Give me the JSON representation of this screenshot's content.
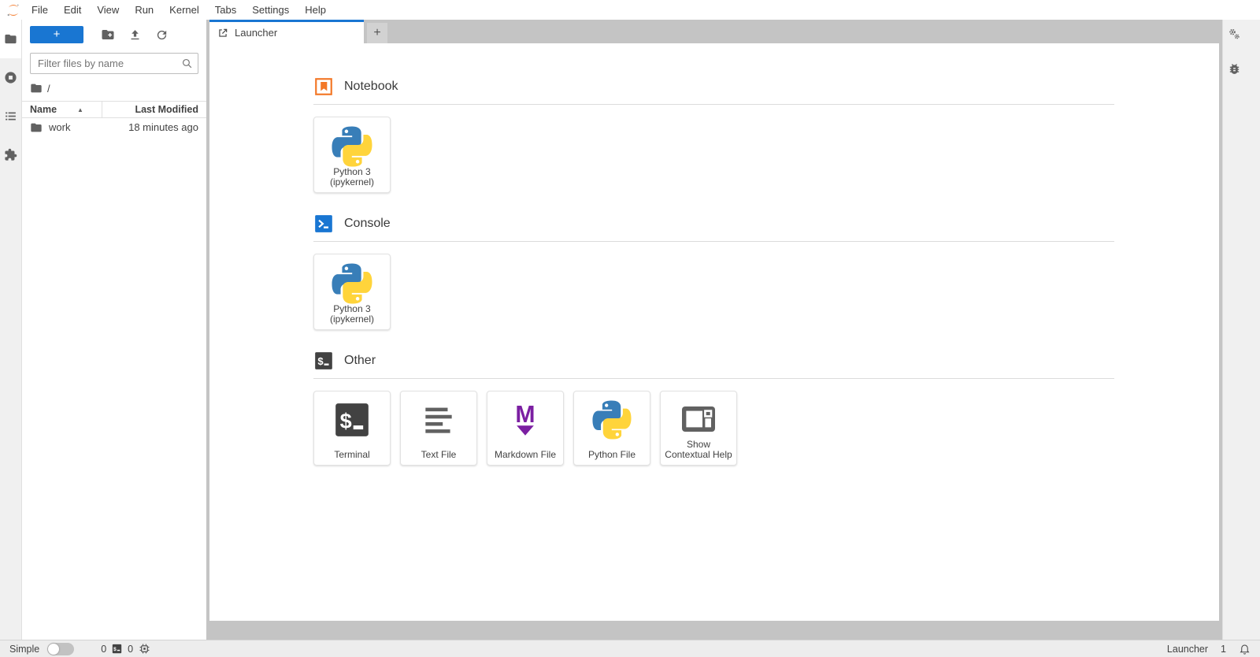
{
  "menubar": {
    "items": [
      "File",
      "Edit",
      "View",
      "Run",
      "Kernel",
      "Tabs",
      "Settings",
      "Help"
    ]
  },
  "sidebar_left": {
    "tabs": [
      {
        "name": "file-browser",
        "icon": "folder-icon",
        "active": true
      },
      {
        "name": "running-kernels",
        "icon": "stop-circle-icon",
        "active": false
      },
      {
        "name": "table-of-contents",
        "icon": "list-icon",
        "active": false
      },
      {
        "name": "extension-manager",
        "icon": "puzzle-icon",
        "active": false
      }
    ]
  },
  "sidebar_right": {
    "tabs": [
      {
        "name": "property-inspector",
        "icon": "gears-icon"
      },
      {
        "name": "debugger",
        "icon": "bug-icon"
      }
    ]
  },
  "file_browser": {
    "new_launcher_label": "+",
    "toolbar_icons": [
      "new-folder-icon",
      "upload-icon",
      "refresh-icon"
    ],
    "filter_placeholder": "Filter files by name",
    "breadcrumb_root": "/",
    "columns": {
      "name": "Name",
      "modified": "Last Modified"
    },
    "sort_indicator": "▲",
    "rows": [
      {
        "name": "work",
        "modified": "18 minutes ago"
      }
    ]
  },
  "dock": {
    "tab_label": "Launcher",
    "add_tab_label": "+"
  },
  "launcher": {
    "sections": [
      {
        "title": "Notebook",
        "cards": [
          {
            "line1": "Python 3",
            "line2": "(ipykernel)",
            "icon": "python-logo"
          }
        ]
      },
      {
        "title": "Console",
        "cards": [
          {
            "line1": "Python 3",
            "line2": "(ipykernel)",
            "icon": "python-logo"
          }
        ]
      },
      {
        "title": "Other",
        "cards": [
          {
            "label": "Terminal",
            "icon": "terminal-icon"
          },
          {
            "label": "Text File",
            "icon": "text-file-icon"
          },
          {
            "label": "Markdown File",
            "icon": "markdown-icon"
          },
          {
            "label": "Python File",
            "icon": "python-logo"
          },
          {
            "label": "Show Contextual Help",
            "icon": "contextual-help-icon"
          }
        ]
      }
    ]
  },
  "statusbar": {
    "simple_label": "Simple",
    "terminal_count": "0",
    "kernel_count": "0",
    "context_label": "Launcher",
    "notification_count": "1"
  },
  "colors": {
    "accent_blue": "#1976d2",
    "jupyter_orange": "#f37726",
    "markdown_purple": "#7b1fa2",
    "icon_gray": "#616161",
    "python_blue": "#387eb8",
    "python_yellow": "#ffd43b"
  }
}
